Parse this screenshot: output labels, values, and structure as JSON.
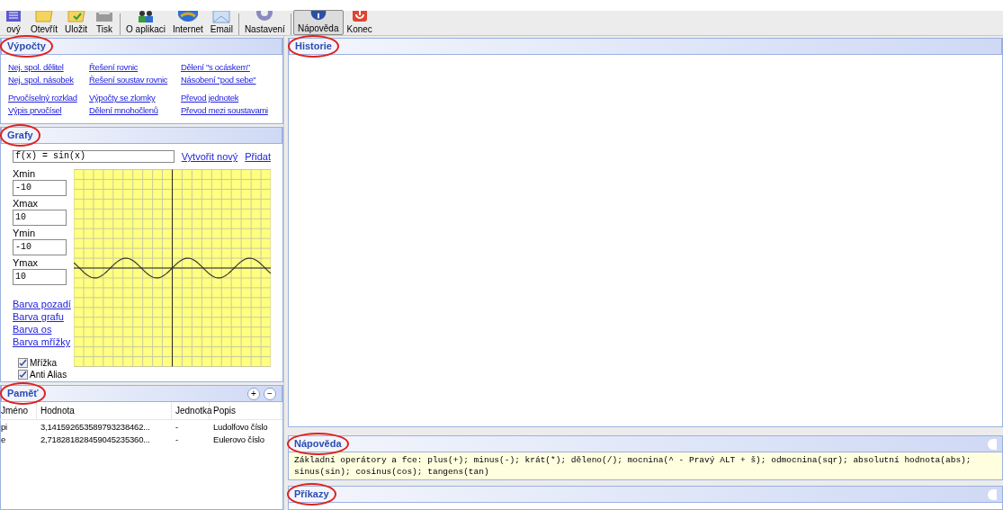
{
  "toolbar": [
    {
      "label": "ový",
      "selected": false
    },
    {
      "label": "Otevřít",
      "selected": false
    },
    {
      "label": "Uložit",
      "selected": false
    },
    {
      "label": "Tisk",
      "selected": false
    },
    {
      "label": "O aplikaci",
      "selected": false
    },
    {
      "label": "Internet",
      "selected": false
    },
    {
      "label": "Email",
      "selected": false
    },
    {
      "label": "Nastavení",
      "selected": false
    },
    {
      "label": "Nápověda",
      "selected": true
    },
    {
      "label": "Konec",
      "selected": false
    }
  ],
  "calculations": {
    "title": "Výpočty",
    "link_groups": [
      [
        [
          "Nej. spol. dělitel",
          "Nej. spol. násobek"
        ],
        [
          "Řešení rovnic",
          "Řešení soustav rovnic"
        ],
        [
          "Dělení \"s ocáskem\"",
          "Násobení \"pod sebe\""
        ]
      ],
      [
        [
          "Prvočíselný rozklad",
          "Výpis prvočísel"
        ],
        [
          "Výpočty se zlomky",
          "Dělení mnohočlenů"
        ],
        [
          "Převod jednotek",
          "Převod mezi soustavami"
        ]
      ]
    ]
  },
  "graphs": {
    "title": "Grafy",
    "function": "f(x) = sin(x)",
    "actions": [
      "Vytvořit nový",
      "Přidat"
    ],
    "fields": [
      {
        "label": "Xmin",
        "value": "-10"
      },
      {
        "label": "Xmax",
        "value": "10"
      },
      {
        "label": "Ymin",
        "value": "-10"
      },
      {
        "label": "Ymax",
        "value": "10"
      }
    ],
    "color_links": [
      "Barva pozadí",
      "Barva grafu",
      "Barva os",
      "Barva mřížky"
    ],
    "options": [
      {
        "label": "Mřížka",
        "checked": true
      },
      {
        "label": "Anti Alias",
        "checked": true
      }
    ]
  },
  "memory": {
    "title": "Paměť",
    "buttons": [
      "+",
      "−"
    ],
    "columns": [
      "Jméno",
      "Hodnota",
      "Jednotka",
      "Popis"
    ],
    "rows": [
      [
        "pi",
        "3,141592653589793238462...",
        "-",
        "Ludolfovo číslo"
      ],
      [
        "e",
        "2,718281828459045235360...",
        "-",
        "Eulerovo číslo"
      ]
    ]
  },
  "history": {
    "title": "Historie"
  },
  "help": {
    "title": "Nápověda",
    "text": "Základní operátory a fce: plus(+); minus(-); krát(*); děleno(/); mocnina(^ - Pravý ALT + š); odmocnina(sqr); absolutní hodnota(abs); sinus(sin); cosinus(cos); tangens(tan)"
  },
  "commands": {
    "title": "Příkazy"
  }
}
